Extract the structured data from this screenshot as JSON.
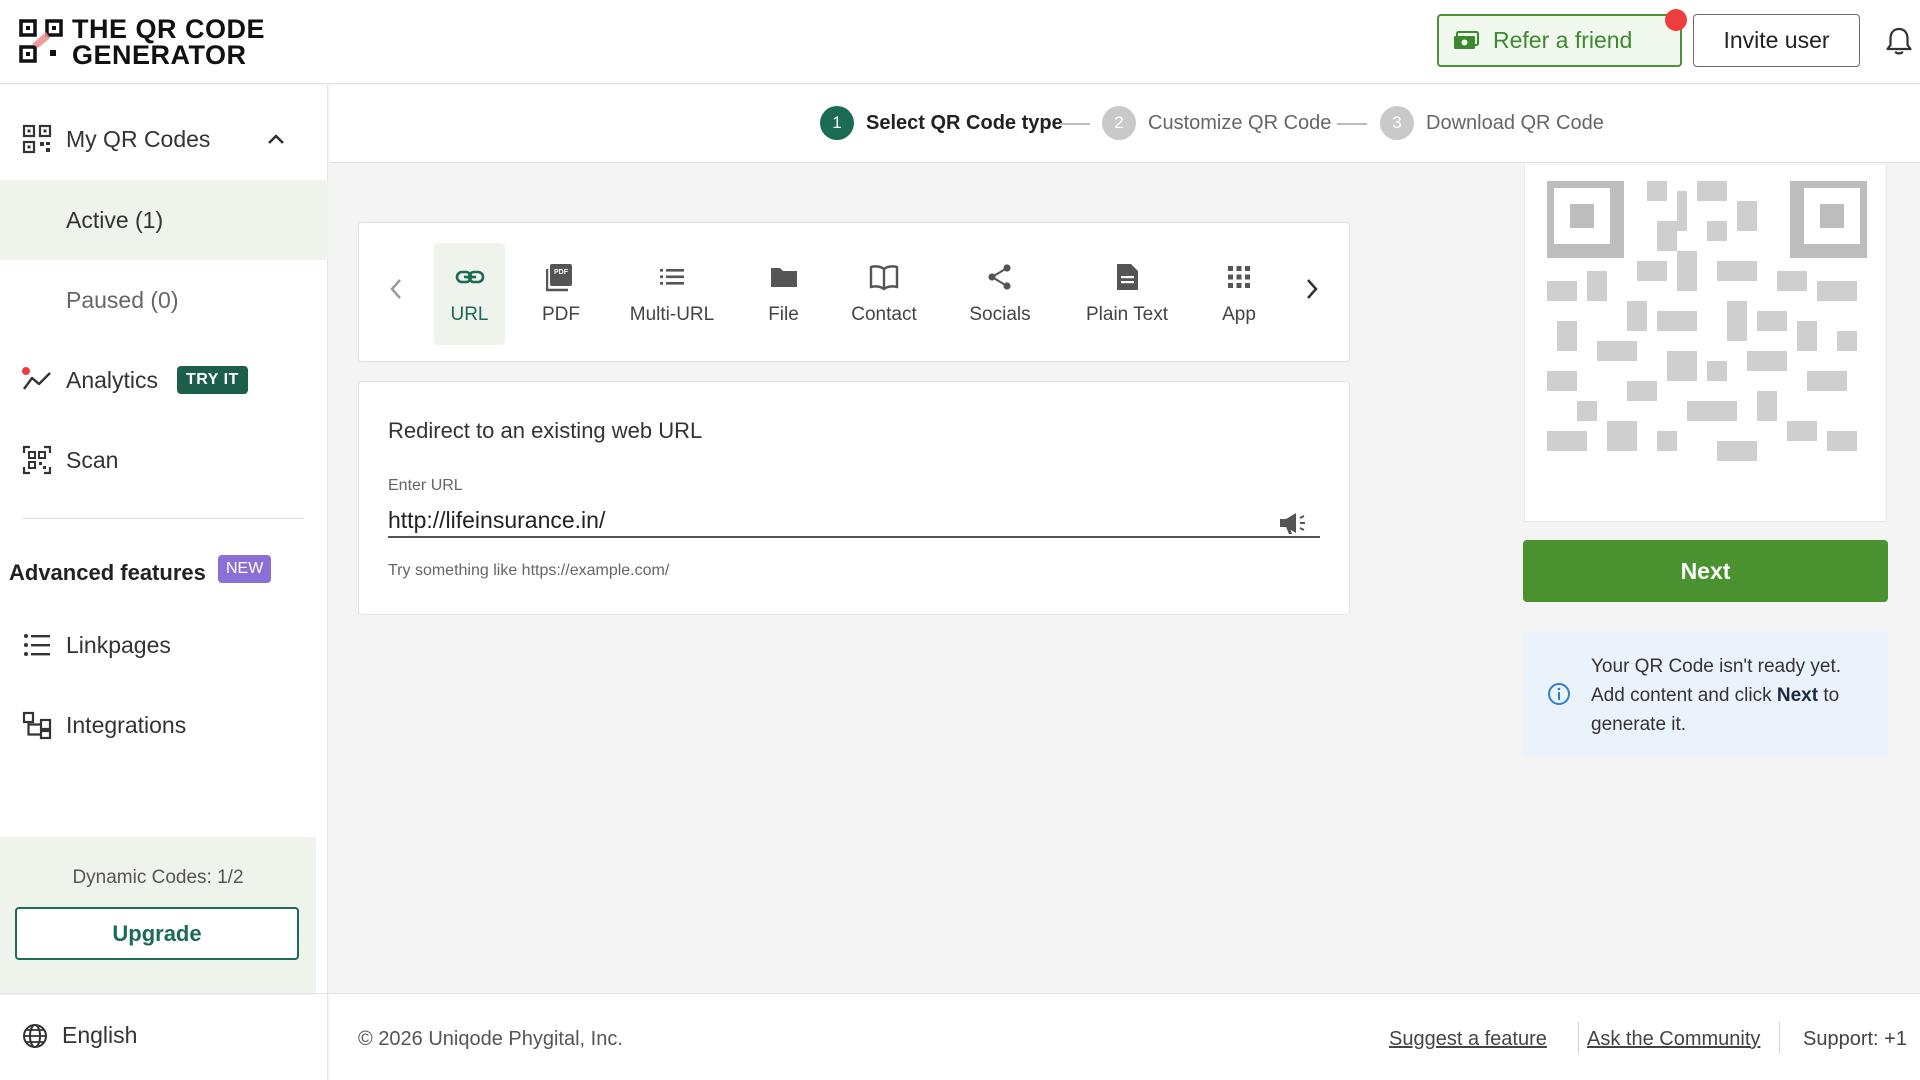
{
  "header": {
    "logo_line1": "THE QR CODE",
    "logo_line2": "GENERATOR",
    "refer_label": "Refer a friend",
    "invite_label": "Invite user"
  },
  "sidebar": {
    "my_qr_codes": "My QR Codes",
    "active": "Active (1)",
    "paused": "Paused (0)",
    "analytics": "Analytics",
    "analytics_badge": "TRY IT",
    "scan": "Scan",
    "advanced_title": "Advanced features",
    "advanced_badge": "NEW",
    "linkpages": "Linkpages",
    "integrations": "Integrations",
    "dynamic_codes": "Dynamic Codes: 1/2",
    "upgrade_label": "Upgrade",
    "language": "English"
  },
  "stepper": {
    "steps": [
      {
        "num": "1",
        "label": "Select QR Code type"
      },
      {
        "num": "2",
        "label": "Customize QR Code"
      },
      {
        "num": "3",
        "label": "Download QR Code"
      }
    ]
  },
  "types": {
    "tabs": [
      "URL",
      "PDF",
      "Multi-URL",
      "File",
      "Contact",
      "Socials",
      "Plain Text",
      "App"
    ],
    "selected": "URL"
  },
  "url_form": {
    "title": "Redirect to an existing web URL",
    "label": "Enter URL",
    "value": "http://lifeinsurance.in/",
    "hint": "Try something like https://example.com/"
  },
  "preview": {
    "next_label": "Next",
    "info_line1": "Your QR Code isn't ready yet.",
    "info_line2_a": "Add content and click ",
    "info_line2_bold": "Next",
    "info_line2_b": " to",
    "info_line3": "generate it."
  },
  "footer": {
    "copyright": "© 2026 Uniqode Phygital, Inc.",
    "suggest": "Suggest a feature",
    "community": "Ask the Community",
    "support": "Support:  +1"
  },
  "colors": {
    "brand_green": "#1b6b55",
    "next_green": "#4a9230",
    "refer_red_dot": "#ee3d3d",
    "new_badge_purple": "#8b6fd6"
  }
}
